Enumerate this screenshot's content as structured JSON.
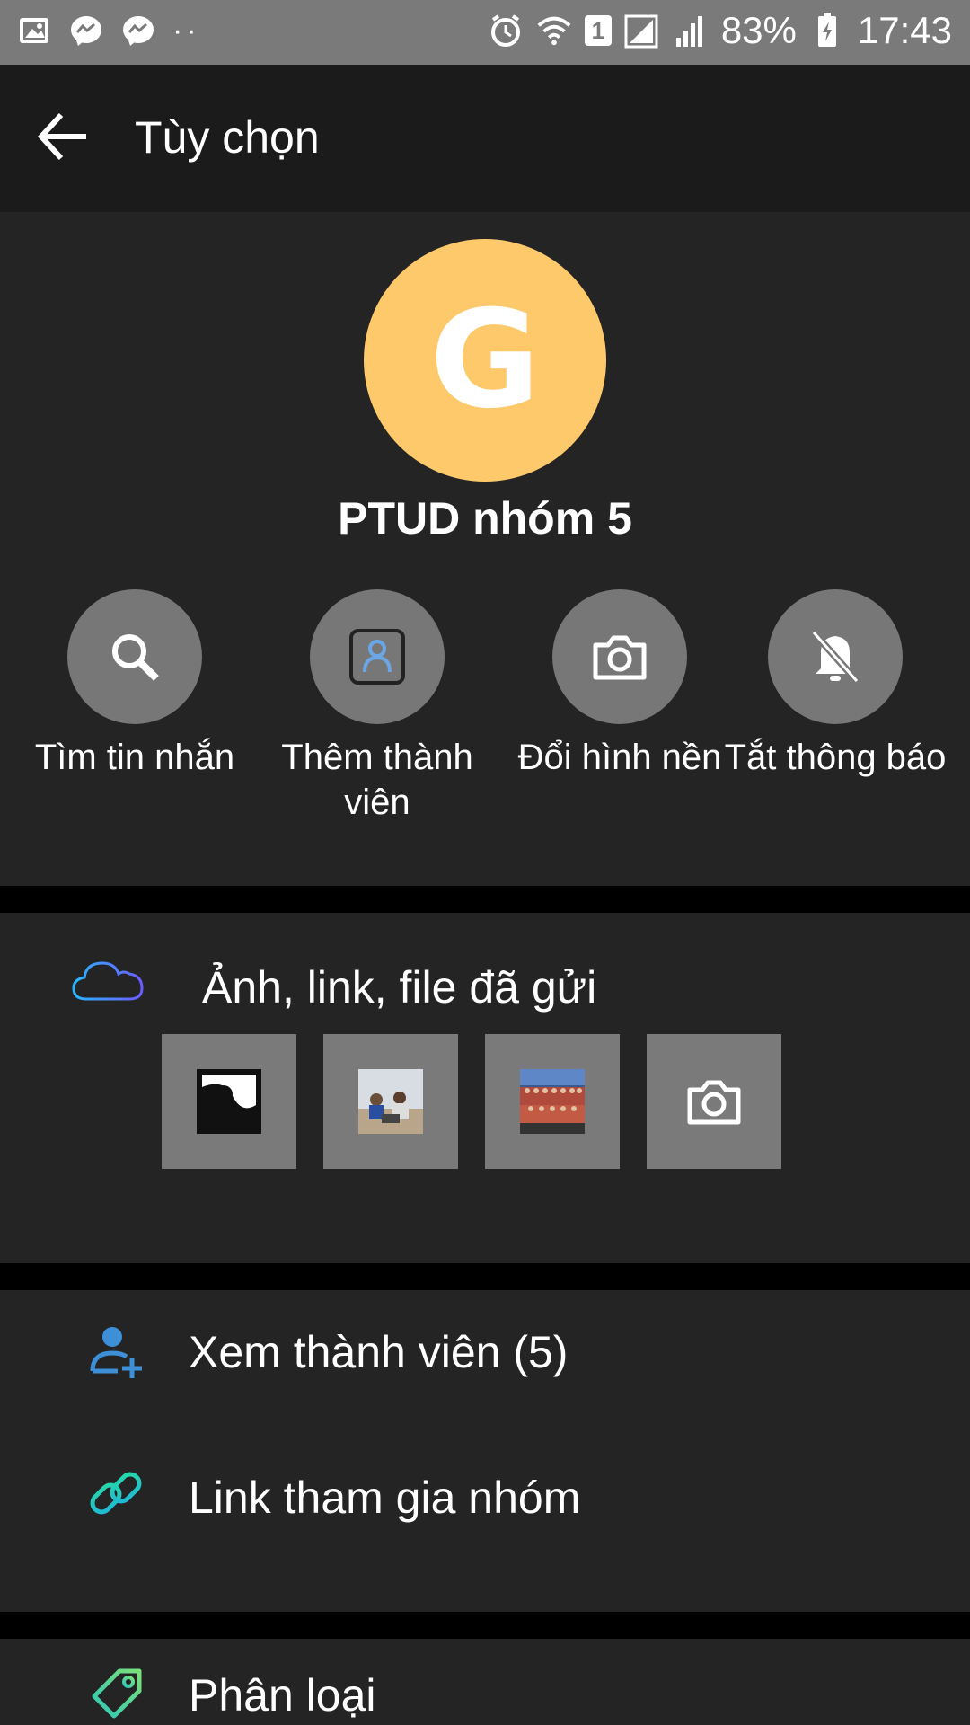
{
  "status_bar": {
    "battery": "83%",
    "time": "17:43",
    "sim": "1",
    "dots": "··"
  },
  "appbar": {
    "title": "Tùy chọn"
  },
  "group": {
    "avatar_letter": "G",
    "name": "PTUD nhóm 5",
    "avatar_color": "#fdc96a"
  },
  "actions": [
    {
      "label": "Tìm tin nhắn",
      "icon": "search-icon"
    },
    {
      "label": "Thêm thành viên",
      "icon": "add-member-icon"
    },
    {
      "label": "Đổi hình nền",
      "icon": "camera-icon"
    },
    {
      "label": "Tắt thông báo",
      "icon": "bell-off-icon"
    }
  ],
  "media": {
    "title": "Ảnh, link, file đã gửi"
  },
  "list": [
    {
      "label": "Xem thành viên (5)",
      "icon": "members-icon"
    },
    {
      "label": "Link tham gia nhóm",
      "icon": "link-icon"
    }
  ],
  "list2": [
    {
      "label": "Phân loại",
      "icon": "tag-icon"
    }
  ]
}
